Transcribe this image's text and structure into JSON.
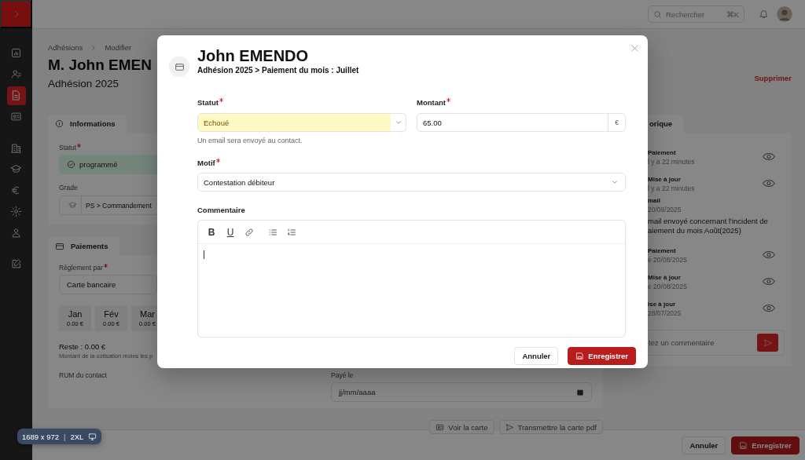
{
  "sidebar": {
    "groups": [
      [
        {
          "selected": false
        },
        {
          "selected": false
        },
        {
          "selected": true
        },
        {
          "selected": false
        }
      ],
      [
        {
          "selected": false
        },
        {
          "selected": false
        },
        {
          "selected": false
        },
        {
          "selected": false
        },
        {
          "selected": false
        }
      ],
      [
        {
          "selected": false
        }
      ]
    ]
  },
  "topbar": {
    "search": {
      "placeholder": "Rechercher",
      "shortcut": "⌘K"
    }
  },
  "breadcrumb": [
    "Adhésions",
    "Modifier"
  ],
  "title": "M. John EMEN",
  "subtitle": "Adhésion 2025",
  "delete_link": "Supprimer",
  "informations": {
    "tab": "Informations",
    "statut_label": "Statut",
    "statut_required": true,
    "statut_value": "programmé",
    "grade_label": "Grade",
    "grade_value": "PS > Commandement"
  },
  "paiements": {
    "tab": "Paiements",
    "method_label": "Règlement par",
    "method_required": true,
    "method_value": "Carte bancaire",
    "months": [
      {
        "name": "Jan",
        "amount": "0.00 €"
      },
      {
        "name": "Fév",
        "amount": "0.00 €"
      },
      {
        "name": "Mar",
        "amount": "0.00 €"
      }
    ],
    "remaining": "Reste : 0.00 €",
    "remaining_note": "Montant de la cotisation moins les p",
    "rum_label": "RUM du contact",
    "paid_label": "Payé le",
    "paid_placeholder": "jj/mm/aaaa"
  },
  "card_actions": [
    "Voir la carte",
    "Transmettre la carte pdf"
  ],
  "history": {
    "tab": "orique",
    "entries": [
      {
        "kind": "event",
        "title": "Paiement",
        "subtitle": "l y a 22 minutes"
      },
      {
        "kind": "event",
        "title": "Mise à jour",
        "subtitle": "l y a 22 minutes"
      },
      {
        "kind": "email",
        "title": "mail",
        "subtitle": "20/08/2025",
        "body_lines": [
          "mail envoyé concernant l'incident de",
          "aiement du mois Août(2025)"
        ]
      },
      {
        "kind": "event",
        "title": "Paiement",
        "subtitle": "e 20/08/2025"
      },
      {
        "kind": "event",
        "title": "Mise à jour",
        "subtitle": "e 20/08/2025"
      },
      {
        "kind": "event",
        "title": "ise à jour",
        "subtitle": "28/07/2025"
      }
    ],
    "comment_placeholder": "tez un commentaire"
  },
  "footer": {
    "cancel": "Annuler",
    "save": "Enregistrer"
  },
  "modal": {
    "title": "John EMENDO",
    "subtitle": "Adhésion 2025 > Paiement du mois : Juillet",
    "statut": {
      "label": "Statut",
      "required": true,
      "value": "Echoué",
      "helper": "Un email sera envoyé au contact."
    },
    "montant": {
      "label": "Montant",
      "required": true,
      "value": "65.00",
      "suffix": "€"
    },
    "motif": {
      "label": "Motif",
      "required": true,
      "value": "Contestation débiteur"
    },
    "comment": {
      "label": "Commentaire",
      "toolbar": [
        {
          "kind": "bold",
          "label": "B"
        },
        {
          "kind": "underline",
          "label": "U"
        },
        {
          "kind": "link"
        },
        {
          "kind": "bullet-list"
        },
        {
          "kind": "numbered-list"
        }
      ]
    },
    "cancel": "Annuler",
    "save": "Enregistrer"
  },
  "viewport_badge": {
    "size": "1689 x 972",
    "separator": "|",
    "breakpoint": "2XL"
  }
}
